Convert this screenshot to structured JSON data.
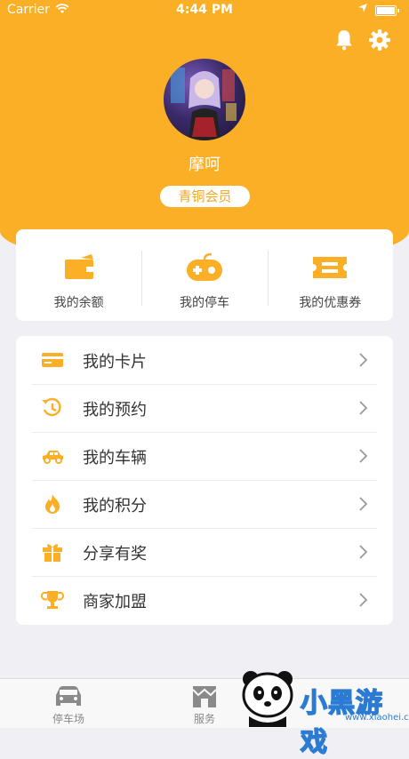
{
  "status_bar": {
    "carrier": "Carrier",
    "time": "4:44 PM"
  },
  "profile": {
    "name": "摩呵",
    "member_level": "青铜会员"
  },
  "stats": [
    {
      "label": "我的余额",
      "icon": "wallet-icon"
    },
    {
      "label": "我的停车",
      "icon": "parking-icon"
    },
    {
      "label": "我的优惠券",
      "icon": "coupon-icon"
    }
  ],
  "menu": [
    {
      "label": "我的卡片",
      "icon": "card-icon"
    },
    {
      "label": "我的预约",
      "icon": "history-icon"
    },
    {
      "label": "我的车辆",
      "icon": "car-icon"
    },
    {
      "label": "我的积分",
      "icon": "flame-icon"
    },
    {
      "label": "分享有奖",
      "icon": "gift-icon"
    },
    {
      "label": "商家加盟",
      "icon": "trophy-icon"
    }
  ],
  "tabs": [
    {
      "label": "停车场",
      "icon": "car-front-icon"
    },
    {
      "label": "服务",
      "icon": "shop-icon"
    }
  ],
  "watermark": {
    "brand": "小黑游戏",
    "url": "www.xiaohei.com"
  },
  "colors": {
    "accent": "#fbaf26",
    "background": "#efeff4",
    "card": "#ffffff"
  }
}
